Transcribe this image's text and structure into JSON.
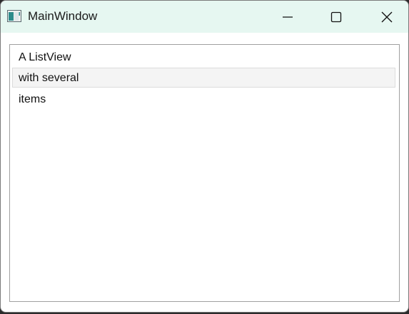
{
  "window": {
    "title": "MainWindow"
  },
  "caption_buttons": {
    "minimize_icon": "minimize-icon",
    "maximize_icon": "maximize-icon",
    "close_icon": "close-icon"
  },
  "listview": {
    "items": [
      {
        "label": "A ListView"
      },
      {
        "label": "with several",
        "state": "hover"
      },
      {
        "label": "items"
      }
    ]
  },
  "colors": {
    "titlebar_bg": "#e6f7f1",
    "item_hover_bg": "#f4f4f4",
    "list_border": "#a0a0a0"
  }
}
